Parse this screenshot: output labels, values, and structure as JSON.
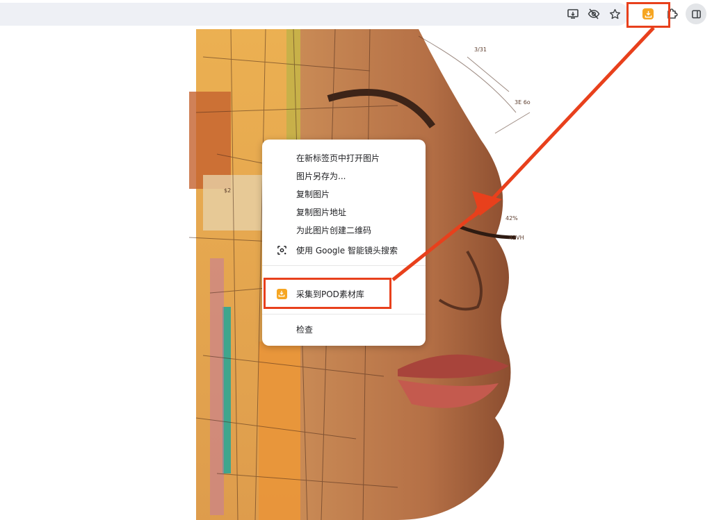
{
  "toolbar": {
    "icons": [
      "install-app-icon",
      "eye-slash-icon",
      "star-icon",
      "pod-extension-icon",
      "puzzle-icon",
      "side-panel-icon"
    ],
    "accent_color": "#f6a623",
    "highlight_color": "#e8401c"
  },
  "context_menu": {
    "items": [
      {
        "label": "在新标签页中打开图片"
      },
      {
        "label": "图片另存为..."
      },
      {
        "label": "复制图片"
      },
      {
        "label": "复制图片地址"
      },
      {
        "label": "为此图片创建二维码"
      },
      {
        "label": "使用 Google 智能镜头搜索",
        "icon": "lens-icon"
      }
    ],
    "extension_item": {
      "label": "采集到POD素材库",
      "icon": "pod-extension-icon"
    },
    "inspect_item": {
      "label": "检查"
    }
  },
  "artwork": {
    "annotations": [
      "3/31",
      "3E 6o",
      "$2",
      "42%",
      "42VH"
    ]
  }
}
